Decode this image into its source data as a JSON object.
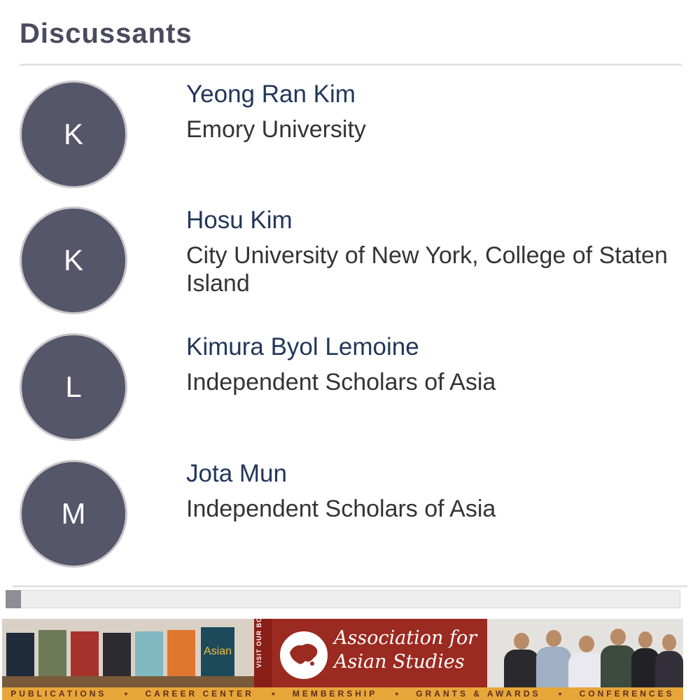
{
  "section": {
    "title": "Discussants"
  },
  "discussants": [
    {
      "initial": "K",
      "name": "Yeong Ran Kim",
      "affiliation": "Emory University"
    },
    {
      "initial": "K",
      "name": "Hosu Kim",
      "affiliation": "City University of New York, College of Staten Island"
    },
    {
      "initial": "L",
      "name": "Kimura Byol Lemoine",
      "affiliation": "Independent Scholars of Asia"
    },
    {
      "initial": "M",
      "name": "Jota Mun",
      "affiliation": "Independent Scholars of Asia"
    }
  ],
  "banner": {
    "booth_label": "VISIT OUR BOOTH",
    "org_name_line1": "Association for",
    "org_name_line2": "Asian Studies",
    "book_cover_text": "Asian",
    "nav": [
      "PUBLICATIONS",
      "CAREER CENTER",
      "MEMBERSHIP",
      "GRANTS & AWARDS",
      "CONFERENCES"
    ],
    "colors": {
      "red": "#9b2a21",
      "gold": "#e8a63a"
    }
  },
  "theme": {
    "avatar_bg": "#56566a",
    "name_color": "#23365b",
    "title_color": "#4a4b5e"
  }
}
